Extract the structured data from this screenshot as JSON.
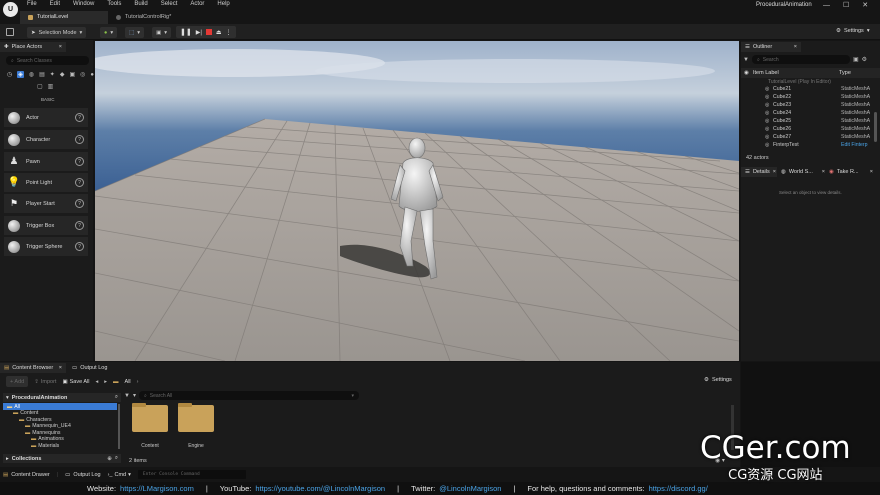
{
  "app": {
    "logo": "U",
    "menu": [
      "File",
      "Edit",
      "Window",
      "Tools",
      "Build",
      "Select",
      "Actor",
      "Help"
    ],
    "window_title": "ProceduralAnimation",
    "window_controls": [
      "—",
      "☐",
      "✕"
    ]
  },
  "tabs": [
    {
      "label": "TutorialLevel",
      "active": true
    },
    {
      "label": "TutorialControlRig*",
      "active": false
    }
  ],
  "toolbar": {
    "selection_mode": "Selection Mode",
    "settings": "Settings"
  },
  "place_actors": {
    "tab_label": "Place Actors",
    "search_placeholder": "Search Classes",
    "category": "BASIC",
    "items": [
      {
        "label": "Actor"
      },
      {
        "label": "Character"
      },
      {
        "label": "Pawn"
      },
      {
        "label": "Point Light"
      },
      {
        "label": "Player Start"
      },
      {
        "label": "Trigger Box"
      },
      {
        "label": "Trigger Sphere"
      }
    ],
    "help_glyph": "?"
  },
  "outliner": {
    "tab_label": "Outliner",
    "search_placeholder": "Search",
    "col_label": "Item Label",
    "col_type": "Type",
    "level_row": "TutorialLevel (Play In Editor)",
    "rows": [
      {
        "name": "Cube21",
        "type": "StaticMeshA"
      },
      {
        "name": "Cube22",
        "type": "StaticMeshA"
      },
      {
        "name": "Cube23",
        "type": "StaticMeshA"
      },
      {
        "name": "Cube24",
        "type": "StaticMeshA"
      },
      {
        "name": "Cube25",
        "type": "StaticMeshA"
      },
      {
        "name": "Cube26",
        "type": "StaticMeshA"
      },
      {
        "name": "Cube27",
        "type": "StaticMeshA"
      },
      {
        "name": "FinterpTest",
        "type": "Edit Finterp"
      }
    ],
    "actor_count": "42 actors"
  },
  "details": {
    "tabs": [
      "Details",
      "World S...",
      "Take R..."
    ],
    "empty_message": "Select an object to view details."
  },
  "content_browser": {
    "tabs": [
      "Content Browser",
      "Output Log"
    ],
    "add": "+ Add",
    "import": "Import",
    "save_all": "Save All",
    "breadcrumb": "All",
    "settings": "Settings",
    "project": "ProceduralAnimation",
    "search_placeholder": "Search All",
    "tree": [
      "All",
      "Content",
      "Characters",
      "Mannequin_UE4",
      "Mannequins",
      "Animations",
      "Materials"
    ],
    "folders": [
      "Content",
      "Engine"
    ],
    "item_count": "2 items",
    "collections": "Collections"
  },
  "statusbar": {
    "content_drawer": "Content Drawer",
    "output_log": "Output Log",
    "cmd": "Cmd",
    "console_placeholder": "Enter Console Command"
  },
  "footer": {
    "website_label": "Website:",
    "website_url": "https://LMargison.com",
    "youtube_label": "YouTube:",
    "youtube_url": "https://youtube.com/@LincolnMargison",
    "twitter_label": "Twitter:",
    "twitter_handle": "@LincolnMargison",
    "help_label": "For help, questions and comments:",
    "help_url": "https://discord.gg/",
    "sep": "|"
  },
  "watermark": {
    "line1": "CGer.com",
    "line2": "CG资源 CG网站"
  },
  "colors": {
    "accent_blue": "#3a7bd5",
    "folder": "#c9a25a",
    "link": "#4aa3e6",
    "sky_top": "#a9b9cf",
    "floor": "#a6a19c"
  }
}
